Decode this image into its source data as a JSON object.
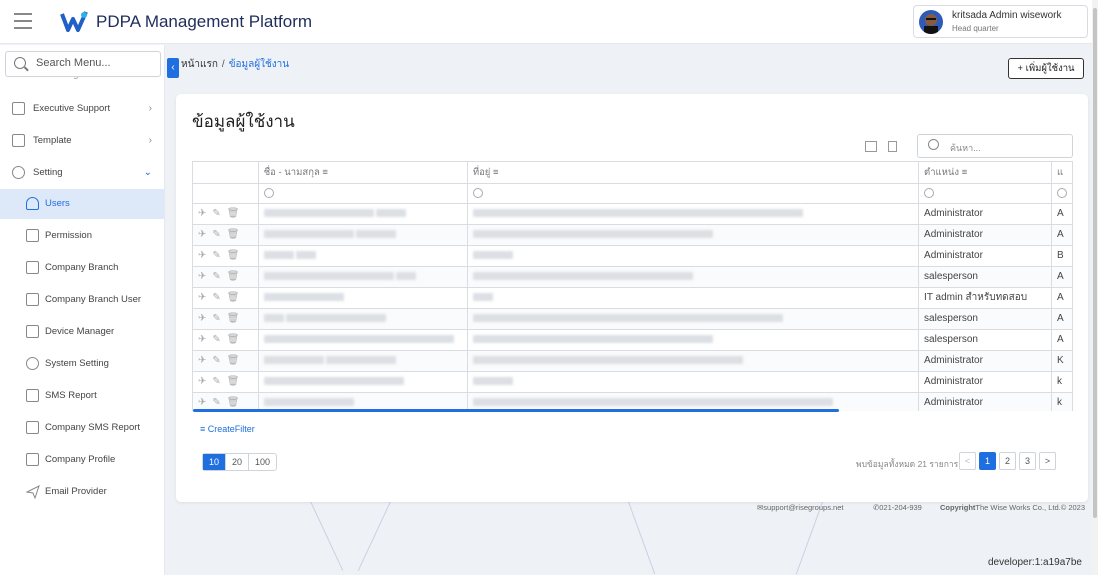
{
  "app": {
    "title": "PDPA Management Platform",
    "user_name": "kritsada Admin wisework",
    "user_location": "Head quarter"
  },
  "sidebar": {
    "search_placeholder": "Search Menu...",
    "partial_item": "LIA Management",
    "items": [
      {
        "label": "Executive Support",
        "icon": "calendar-icon",
        "has_chevron": true
      },
      {
        "label": "Template",
        "icon": "template-icon",
        "has_chevron": true
      },
      {
        "label": "Setting",
        "icon": "gear-icon",
        "expanded": true
      },
      {
        "label": "Users",
        "icon": "user-icon",
        "active": true
      },
      {
        "label": "Permission",
        "icon": "lock-icon"
      },
      {
        "label": "Company Branch",
        "icon": "list-icon"
      },
      {
        "label": "Company Branch User",
        "icon": "list-icon"
      },
      {
        "label": "Device Manager",
        "icon": "monitor-icon"
      },
      {
        "label": "System Setting",
        "icon": "gear-icon"
      },
      {
        "label": "SMS Report",
        "icon": "list-icon"
      },
      {
        "label": "Company SMS Report",
        "icon": "list-icon"
      },
      {
        "label": "Company Profile",
        "icon": "list-icon"
      },
      {
        "label": "Email Provider",
        "icon": "send-icon"
      }
    ]
  },
  "breadcrumb": {
    "home": "หน้าแรก",
    "separator": "/",
    "current": "ข้อมูลผู้ใช้งาน"
  },
  "add_user_button": "+ เพิ่มผู้ใช้งาน",
  "page_title": "ข้อมูลผู้ใช้งาน",
  "search_placeholder": "ค้นหา...",
  "table": {
    "columns": [
      "ชื่อ - นามสกุล",
      "ที่อยู่",
      "ตำแหน่ง",
      "แ"
    ],
    "rows": [
      {
        "position": "Administrator",
        "extra": "A"
      },
      {
        "position": "Administrator",
        "extra": "A"
      },
      {
        "position": "Administrator",
        "extra": "B"
      },
      {
        "position": "salesperson",
        "extra": "A"
      },
      {
        "position": "IT admin สำหรับทดสอบ",
        "extra": "A"
      },
      {
        "position": "salesperson",
        "extra": "A"
      },
      {
        "position": "salesperson",
        "extra": "A"
      },
      {
        "position": "Administrator",
        "extra": "K"
      },
      {
        "position": "Administrator",
        "extra": "k"
      },
      {
        "position": "Administrator",
        "extra": "k"
      }
    ]
  },
  "create_filter": "CreateFilter",
  "page_sizes": [
    "10",
    "20",
    "100"
  ],
  "selected_page_size": "10",
  "total_text": "พบข้อมูลทั้งหมด 21 รายการ",
  "pager": [
    "<",
    "1",
    "2",
    "3",
    ">"
  ],
  "current_page": "1",
  "footer": {
    "email": "support@risegroups.net",
    "phone": "021-204-939",
    "copyright_label": "Copyright",
    "copyright_text": "The Wise Works Co., Ltd.© 2023"
  },
  "developer": "developer:1:a19a7be",
  "colors": {
    "accent": "#1f6fe0",
    "title": "#1f2d5a"
  }
}
